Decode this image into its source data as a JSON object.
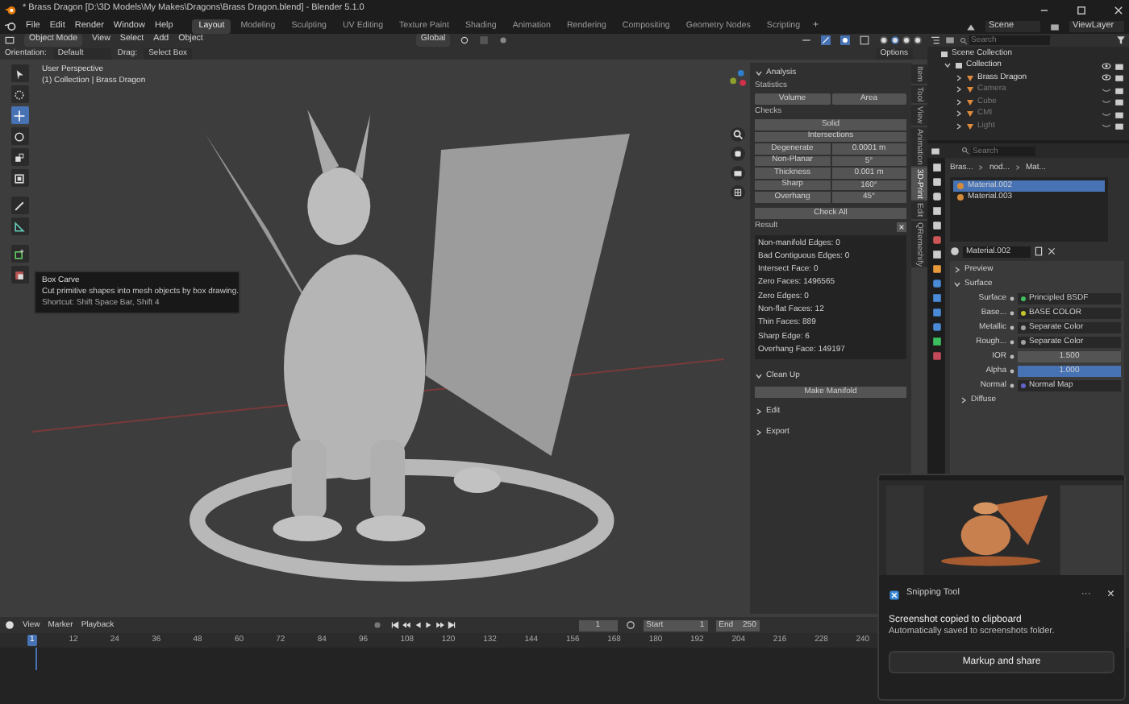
{
  "window": {
    "title": "* Brass Dragon [D:\\3D Models\\My Makes\\Dragons\\Brass Dragon.blend] - Blender 5.1.0"
  },
  "menu": [
    "File",
    "Edit",
    "Render",
    "Window",
    "Help"
  ],
  "workspaces": [
    {
      "label": "Layout",
      "selected": true
    },
    {
      "label": "Modeling",
      "selected": false
    },
    {
      "label": "Sculpting",
      "selected": false
    },
    {
      "label": "UV Editing",
      "selected": false
    },
    {
      "label": "Texture Paint",
      "selected": false
    },
    {
      "label": "Shading",
      "selected": false
    },
    {
      "label": "Animation",
      "selected": false
    },
    {
      "label": "Rendering",
      "selected": false
    },
    {
      "label": "Compositing",
      "selected": false
    },
    {
      "label": "Geometry Nodes",
      "selected": false
    },
    {
      "label": "Scripting",
      "selected": false
    }
  ],
  "add_workspace": "+",
  "scene": "Scene",
  "view_layer": "ViewLayer",
  "viewport_header": {
    "mode": "Object Mode",
    "menus": [
      "View",
      "Select",
      "Add",
      "Object"
    ],
    "transform": "Global"
  },
  "tool_settings": {
    "orientation_label": "Orientation:",
    "orientation": "Default",
    "drag_label": "Drag:",
    "drag": "Select Box",
    "options": "Options"
  },
  "viewport": {
    "perspective": "User Perspective",
    "collection": "(1) Collection | Brass Dragon"
  },
  "toolbar": [
    {
      "kind": "select",
      "selected": false
    },
    {
      "kind": "cursor",
      "selected": false
    },
    {
      "kind": "move",
      "selected": true
    },
    {
      "kind": "rotate",
      "selected": false
    },
    {
      "kind": "scale",
      "selected": false
    },
    {
      "kind": "transform",
      "selected": false
    },
    {
      "kind": "annotate",
      "selected": false
    },
    {
      "kind": "measure",
      "selected": false
    },
    {
      "kind": "add",
      "selected": false
    },
    {
      "kind": "carve",
      "selected": false
    }
  ],
  "tooltip": {
    "title": "Box Carve",
    "description": "Cut primitive shapes into mesh objects by box drawing.",
    "shortcut": "Shortcut: Shift Space Bar, Shift 4"
  },
  "sidebar": {
    "tabs": [
      {
        "label": "Item",
        "selected": false
      },
      {
        "label": "Tool",
        "selected": false
      },
      {
        "label": "View",
        "selected": false
      },
      {
        "label": "Animation",
        "selected": false
      },
      {
        "label": "3D-Print",
        "selected": true
      },
      {
        "label": "Edit",
        "selected": false
      },
      {
        "label": "QRemeshify",
        "selected": false
      }
    ],
    "analysis": {
      "title": "Analysis",
      "expanded": true,
      "statistics_label": "Statistics",
      "statistics_buttons": [
        "Volume",
        "Area"
      ],
      "checks_label": "Checks",
      "checks": [
        {
          "label": "Solid"
        },
        {
          "label": "Intersections"
        },
        {
          "label": "Degenerate",
          "value": "0.0001 m"
        },
        {
          "label": "Non-Planar",
          "value": "5°"
        },
        {
          "label": "Thickness",
          "value": "0.001 m"
        },
        {
          "label": "Sharp",
          "value": "160°"
        },
        {
          "label": "Overhang",
          "value": "45°"
        }
      ],
      "check_all": "Check All",
      "result_label": "Result",
      "result": [
        "Non-manifold Edges: 0",
        "Bad Contiguous Edges: 0",
        "Intersect Face: 0",
        "Zero Faces: 1496565",
        "Zero Edges: 0",
        "Non-flat Faces: 12",
        "Thin Faces: 889",
        "Sharp Edge: 6",
        "Overhang Face: 149197"
      ]
    },
    "clean_up": {
      "title": "Clean Up",
      "expanded": true,
      "button": "Make Manifold"
    },
    "more_panels": [
      {
        "title": "Edit",
        "expanded": false
      },
      {
        "title": "Export",
        "expanded": false
      }
    ]
  },
  "outliner": {
    "search": {
      "placeholder": "Search"
    },
    "root": "Scene Collection",
    "tree": [
      {
        "label": "Collection",
        "expanded": true,
        "visible": true,
        "children": [
          {
            "label": "Brass Dragon",
            "visible": true
          },
          {
            "label": "Camera",
            "visible": false
          },
          {
            "label": "Cube",
            "visible": false
          },
          {
            "label": "CMI",
            "visible": false
          },
          {
            "label": "Light",
            "visible": false
          }
        ]
      }
    ]
  },
  "properties": {
    "search": {
      "placeholder": "Search"
    },
    "breadcrumb": [
      "Bras...",
      "nod...",
      "Mat..."
    ],
    "slots": [
      {
        "label": "Material.002",
        "selected": true
      },
      {
        "label": "Material.003",
        "selected": false
      }
    ],
    "material": "Material.002",
    "panels": [
      {
        "title": "Preview",
        "expanded": false
      },
      {
        "title": "Surface",
        "expanded": true
      }
    ],
    "rows": [
      {
        "kind": "link",
        "label": "Surface",
        "value": "Principled BSDF",
        "color": "#3fbf5f"
      },
      {
        "kind": "link",
        "label": "Base...",
        "value": "BASE COLOR",
        "color": "#c7c729"
      },
      {
        "kind": "link",
        "label": "Metallic",
        "value": "Separate Color",
        "color": "#a1a1a1"
      },
      {
        "kind": "link",
        "label": "Rough...",
        "value": "Separate Color",
        "color": "#a1a1a1"
      },
      {
        "kind": "slider",
        "label": "IOR",
        "value": "1.500",
        "level": 0
      },
      {
        "kind": "slider",
        "label": "Alpha",
        "value": "1.000",
        "level": 1
      },
      {
        "kind": "link",
        "label": "Normal",
        "value": "Normal Map",
        "color": "#6363c7"
      }
    ],
    "subpanels": [
      {
        "title": "Diffuse",
        "expanded": false
      }
    ]
  },
  "timeline": {
    "menus": [
      "View",
      "Marker",
      "Playback"
    ],
    "current_frame": "1",
    "start_label": "Start",
    "start": "1",
    "end_label": "End",
    "end": "250",
    "ticks": [
      "1",
      "12",
      "24",
      "36",
      "48",
      "60",
      "72",
      "84",
      "96",
      "108",
      "120",
      "132",
      "144",
      "156",
      "168",
      "180",
      "192",
      "204",
      "216",
      "228",
      "240"
    ]
  },
  "notification": {
    "app": "Snipping Tool",
    "more": "···",
    "close": "×",
    "title": "Screenshot copied to clipboard",
    "message": "Automatically saved to screenshots folder.",
    "button": "Markup and share"
  }
}
